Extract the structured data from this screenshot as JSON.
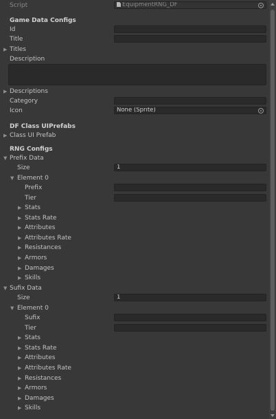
{
  "script": {
    "label": "Script",
    "value": "EquipmentRNG_DF"
  },
  "game_data": {
    "header": "Game Data Configs",
    "id_label": "Id",
    "id_value": "",
    "title_label": "Title",
    "title_value": "",
    "titles_label": "Titles",
    "description_label": "Description",
    "descriptions_label": "Descriptions",
    "category_label": "Category",
    "category_value": "",
    "icon_label": "Icon",
    "icon_value": "None (Sprite)"
  },
  "df_class": {
    "header": "DF Class UIPrefabs",
    "class_ui_prefab_label": "Class UI Prefab"
  },
  "rng": {
    "header": "RNG Configs",
    "prefix": {
      "label": "Prefix Data",
      "size_label": "Size",
      "size_value": "1",
      "element_label": "Element 0",
      "name_label": "Prefix",
      "name_value": "",
      "tier_label": "Tier",
      "tier_value": "",
      "children": [
        "Stats",
        "Stats Rate",
        "Attributes",
        "Attributes Rate",
        "Resistances",
        "Armors",
        "Damages",
        "Skills"
      ]
    },
    "sufix": {
      "label": "Sufix Data",
      "size_label": "Size",
      "size_value": "1",
      "element_label": "Element 0",
      "name_label": "Sufix",
      "name_value": "",
      "tier_label": "Tier",
      "tier_value": "",
      "children": [
        "Stats",
        "Stats Rate",
        "Attributes",
        "Attributes Rate",
        "Resistances",
        "Armors",
        "Damages",
        "Skills"
      ]
    }
  }
}
